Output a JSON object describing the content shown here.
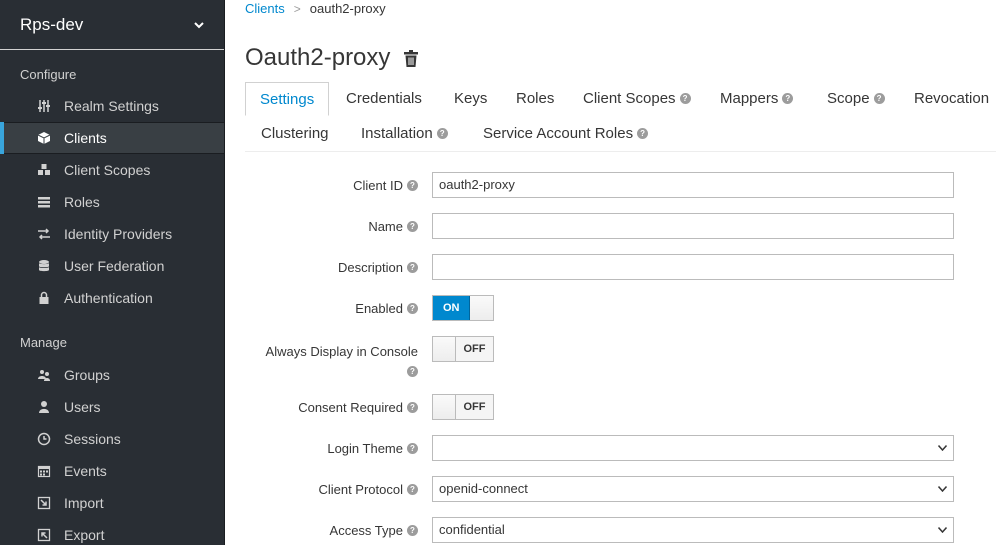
{
  "sidebar": {
    "realm": "Rps-dev",
    "configure_title": "Configure",
    "manage_title": "Manage",
    "configure_items": [
      {
        "label": "Realm Settings"
      },
      {
        "label": "Clients"
      },
      {
        "label": "Client Scopes"
      },
      {
        "label": "Roles"
      },
      {
        "label": "Identity Providers"
      },
      {
        "label": "User Federation"
      },
      {
        "label": "Authentication"
      }
    ],
    "manage_items": [
      {
        "label": "Groups"
      },
      {
        "label": "Users"
      },
      {
        "label": "Sessions"
      },
      {
        "label": "Events"
      },
      {
        "label": "Import"
      },
      {
        "label": "Export"
      }
    ]
  },
  "breadcrumb": {
    "parent": "Clients",
    "separator": ">",
    "current": "oauth2-proxy"
  },
  "page": {
    "title": "Oauth2-proxy"
  },
  "tabs": [
    {
      "label": "Settings"
    },
    {
      "label": "Credentials"
    },
    {
      "label": "Keys"
    },
    {
      "label": "Roles"
    },
    {
      "label": "Client Scopes"
    },
    {
      "label": "Mappers"
    },
    {
      "label": "Scope"
    },
    {
      "label": "Revocation"
    },
    {
      "label": "Clustering"
    },
    {
      "label": "Installation"
    },
    {
      "label": "Service Account Roles"
    }
  ],
  "form": {
    "client_id": {
      "label": "Client ID",
      "value": "oauth2-proxy"
    },
    "name": {
      "label": "Name",
      "value": ""
    },
    "description": {
      "label": "Description",
      "value": ""
    },
    "enabled": {
      "label": "Enabled",
      "state": "ON"
    },
    "always_display": {
      "label_line1": "Always Display in Console",
      "state": "OFF"
    },
    "consent_required": {
      "label": "Consent Required",
      "state": "OFF"
    },
    "login_theme": {
      "label": "Login Theme",
      "value": ""
    },
    "client_protocol": {
      "label": "Client Protocol",
      "value": "openid-connect"
    },
    "access_type": {
      "label": "Access Type",
      "value": "confidential"
    }
  },
  "colors": {
    "sidebar_bg": "#292e34",
    "accent": "#0088ce",
    "active_bar": "#39a5dc"
  }
}
